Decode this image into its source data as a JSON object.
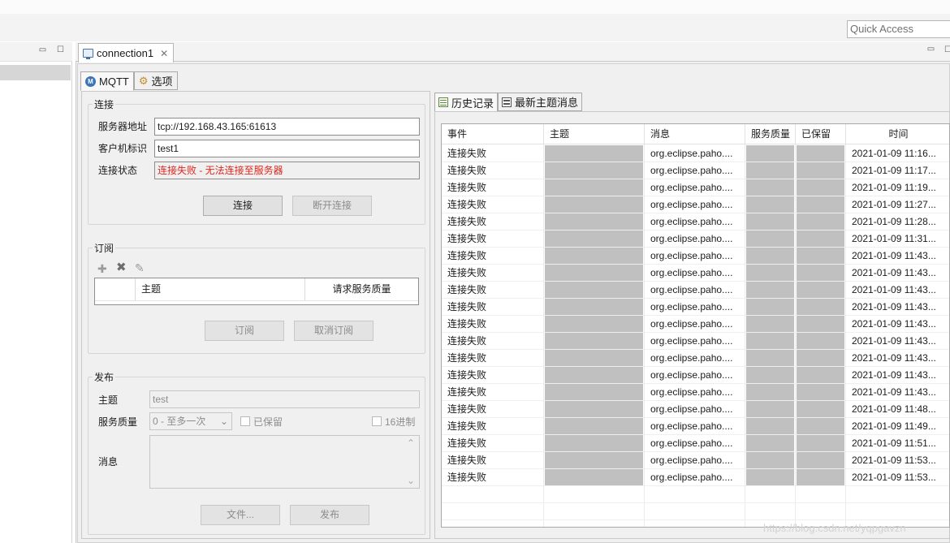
{
  "toolbar": {
    "quick_access_placeholder": "Quick Access"
  },
  "editor": {
    "tab_title": "connection1",
    "inner_tabs": [
      {
        "label": "MQTT",
        "icon": "mqtt-icon"
      },
      {
        "label": "选项",
        "icon": "gear-icon"
      }
    ]
  },
  "connection": {
    "group_label": "连接",
    "server_label": "服务器地址",
    "server_value": "tcp://192.168.43.165:61613",
    "client_label": "客户机标识",
    "client_value": "test1",
    "status_label": "连接状态",
    "status_value": "连接失败 - 无法连接至服务器",
    "connect_button": "连接",
    "disconnect_button": "断开连接"
  },
  "subscribe": {
    "group_label": "订阅",
    "col_topic": "主题",
    "col_qos": "请求服务质量",
    "subscribe_button": "订阅",
    "unsubscribe_button": "取消订阅"
  },
  "publish": {
    "group_label": "发布",
    "topic_label": "主题",
    "topic_value": "test",
    "qos_label": "服务质量",
    "qos_value": "0 - 至多一次",
    "retained_label": "已保留",
    "hex_label": "16进制",
    "message_label": "消息",
    "file_button": "文件...",
    "publish_button": "发布"
  },
  "history": {
    "tabs": [
      {
        "label": "历史记录",
        "icon": "list-icon"
      },
      {
        "label": "最新主题消息",
        "icon": "list-icon"
      }
    ],
    "columns": [
      "事件",
      "主题",
      "消息",
      "服务质量",
      "已保留",
      "时间"
    ],
    "rows": [
      {
        "event": "连接失败",
        "message": "org.eclipse.paho....",
        "time": "2021-01-09 11:16..."
      },
      {
        "event": "连接失败",
        "message": "org.eclipse.paho....",
        "time": "2021-01-09 11:17..."
      },
      {
        "event": "连接失败",
        "message": "org.eclipse.paho....",
        "time": "2021-01-09 11:19..."
      },
      {
        "event": "连接失败",
        "message": "org.eclipse.paho....",
        "time": "2021-01-09 11:27..."
      },
      {
        "event": "连接失败",
        "message": "org.eclipse.paho....",
        "time": "2021-01-09 11:28..."
      },
      {
        "event": "连接失败",
        "message": "org.eclipse.paho....",
        "time": "2021-01-09 11:31..."
      },
      {
        "event": "连接失败",
        "message": "org.eclipse.paho....",
        "time": "2021-01-09 11:43..."
      },
      {
        "event": "连接失败",
        "message": "org.eclipse.paho....",
        "time": "2021-01-09 11:43..."
      },
      {
        "event": "连接失败",
        "message": "org.eclipse.paho....",
        "time": "2021-01-09 11:43..."
      },
      {
        "event": "连接失败",
        "message": "org.eclipse.paho....",
        "time": "2021-01-09 11:43..."
      },
      {
        "event": "连接失败",
        "message": "org.eclipse.paho....",
        "time": "2021-01-09 11:43..."
      },
      {
        "event": "连接失败",
        "message": "org.eclipse.paho....",
        "time": "2021-01-09 11:43..."
      },
      {
        "event": "连接失败",
        "message": "org.eclipse.paho....",
        "time": "2021-01-09 11:43..."
      },
      {
        "event": "连接失败",
        "message": "org.eclipse.paho....",
        "time": "2021-01-09 11:43..."
      },
      {
        "event": "连接失败",
        "message": "org.eclipse.paho....",
        "time": "2021-01-09 11:43..."
      },
      {
        "event": "连接失败",
        "message": "org.eclipse.paho....",
        "time": "2021-01-09 11:48..."
      },
      {
        "event": "连接失败",
        "message": "org.eclipse.paho....",
        "time": "2021-01-09 11:49..."
      },
      {
        "event": "连接失败",
        "message": "org.eclipse.paho....",
        "time": "2021-01-09 11:51..."
      },
      {
        "event": "连接失败",
        "message": "org.eclipse.paho....",
        "time": "2021-01-09 11:53..."
      },
      {
        "event": "连接失败",
        "message": "org.eclipse.paho....",
        "time": "2021-01-09 11:53..."
      }
    ]
  },
  "watermark": "https://blog.csdn.net/yqpgavzn",
  "colors": {
    "error_text": "#e1261c",
    "grey_cell": "#c0c0c0"
  }
}
